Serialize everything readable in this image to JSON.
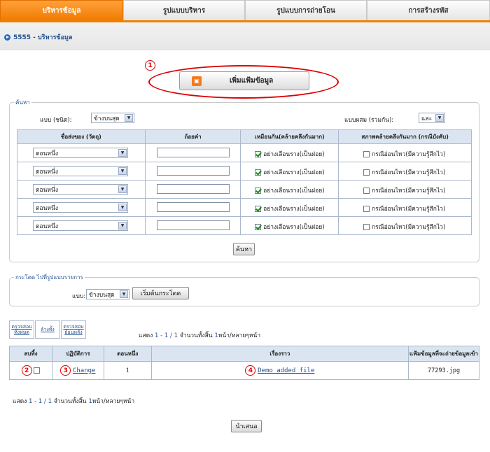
{
  "tabs": [
    {
      "label": "บริหารข้อมูล",
      "active": true
    },
    {
      "label": "รูปแบบบริหาร",
      "active": false
    },
    {
      "label": "รูปแบบการถ่ายโอน",
      "active": false
    },
    {
      "label": "การสร้างรหัส",
      "active": false
    }
  ],
  "breadcrumb": "5555 - บริหารข้อมูล",
  "annotations": [
    "1",
    "2",
    "3",
    "4"
  ],
  "add_button": {
    "label": "เพิ่มแฟ้มข้อมูล"
  },
  "search": {
    "legend": "ค้นหา",
    "mode_label": "แบบ (ชนิด):",
    "mode_value": "ข้างบนสุด",
    "combine_label": "แบบผสม (รวมกัน):",
    "combine_value": "และ",
    "headers": [
      "ชื่อส่งของ (วัตถุ)",
      "ถ้อยคำ",
      "เหมือนกัน(คล้ายคลึงกันมาก)",
      "สภาพคล้ายคลึงกันมาก (กรณีบังคับ)"
    ],
    "rows": [
      {
        "field": "ตอนหนึ่ง",
        "term": "",
        "similar_checked": true,
        "similar_label": "อย่างเลือนราง(เป็นฝอย)",
        "case_checked": false,
        "case_label": "กรณีอ่อนไหว(มีความรู้สึกไว)"
      },
      {
        "field": "ตอนหนึ่ง",
        "term": "",
        "similar_checked": true,
        "similar_label": "อย่างเลือนราง(เป็นฝอย)",
        "case_checked": false,
        "case_label": "กรณีอ่อนไหว(มีความรู้สึกไว)"
      },
      {
        "field": "ตอนหนึ่ง",
        "term": "",
        "similar_checked": true,
        "similar_label": "อย่างเลือนราง(เป็นฝอย)",
        "case_checked": false,
        "case_label": "กรณีอ่อนไหว(มีความรู้สึกไว)"
      },
      {
        "field": "ตอนหนึ่ง",
        "term": "",
        "similar_checked": true,
        "similar_label": "อย่างเลือนราง(เป็นฝอย)",
        "case_checked": false,
        "case_label": "กรณีอ่อนไหว(มีความรู้สึกไว)"
      },
      {
        "field": "ตอนหนึ่ง",
        "term": "",
        "similar_checked": true,
        "similar_label": "อย่างเลือนราง(เป็นฝอย)",
        "case_checked": false,
        "case_label": "กรณีอ่อนไหว(มีความรู้สึกไว)"
      }
    ],
    "button": "ค้นหา"
  },
  "jump": {
    "legend": "กระโดด ไปที่รูปแบบรายการ",
    "label": "แบบ:",
    "value": "ข้างบนสุด",
    "button": "เริ่มต้นกระโดด"
  },
  "list_tools": {
    "check_all": "ตรวจสอบทั้งหมด",
    "clear_all": "ล้างทั้ง",
    "check_back": "ตรวจสอบย้อนหลัง"
  },
  "paging_top": {
    "prefix": "แสดง",
    "range": "1 - 1 / 1",
    "suffix": "จำนวนทั้งสิ้น",
    "pages": "1",
    "unit": "หน้า/หลายๆหน้า"
  },
  "results": {
    "headers": [
      "ลบทิ้ง",
      "ปฏิบัติการ",
      "ตอนหนึ่ง",
      "เรื่องราว",
      "แฟ้มข้อมูลที่จะถ่ายข้อมูลเข้า"
    ],
    "rows": [
      {
        "delete_checked": false,
        "action": "Change",
        "section": "1",
        "title": "Demo added file",
        "file": "77293.jpg"
      }
    ]
  },
  "paging_bottom": {
    "prefix": "แสดง",
    "range": "1 - 1 / 1",
    "suffix": "จำนวนทั้งสิ้น",
    "pages": "1",
    "unit": "หน้า/หลายๆหน้า"
  },
  "submit": "นำเสนอ",
  "colors": {
    "accent": "#f08000",
    "link": "#1e4f8f",
    "header_bg": "#dbe5f1",
    "annotation": "#dd0000"
  }
}
